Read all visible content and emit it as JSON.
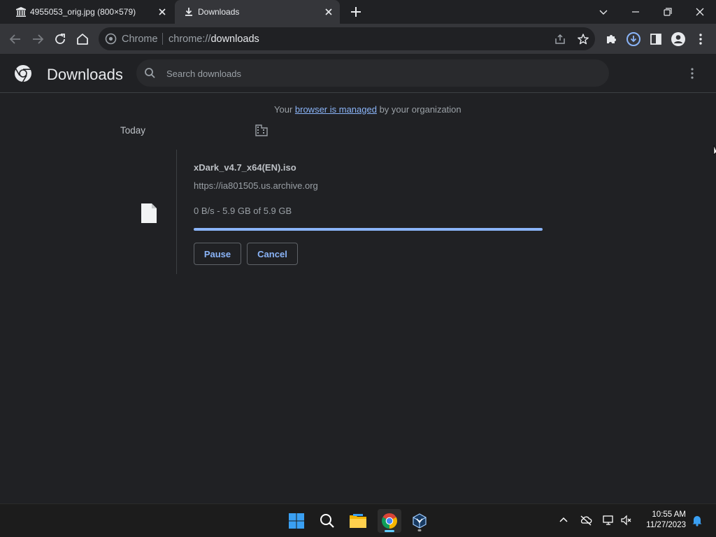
{
  "tabs": [
    {
      "title": "4955053_orig.jpg (800×579)",
      "icon": "archive-building-icon"
    },
    {
      "title": "Downloads",
      "icon": "download-icon"
    }
  ],
  "omnibox": {
    "chip": "Chrome",
    "url_scheme": "chrome://",
    "url_host": "downloads"
  },
  "page": {
    "title": "Downloads",
    "search_placeholder": "Search downloads"
  },
  "managed": {
    "prefix": "Your ",
    "link": "browser is managed",
    "suffix": " by your organization"
  },
  "section_date": "Today",
  "download": {
    "file_name": "xDark_v4.7_x64(EN).iso",
    "url": "https://ia801505.us.archive.org",
    "status": "0 B/s - 5.9 GB of 5.9 GB",
    "progress_percent": 100,
    "pause_label": "Pause",
    "cancel_label": "Cancel"
  },
  "clock": {
    "time": "10:55 AM",
    "date": "11/27/2023"
  },
  "colors": {
    "accent": "#8ab4f8",
    "background": "#202124",
    "toolbar": "#35363a"
  }
}
